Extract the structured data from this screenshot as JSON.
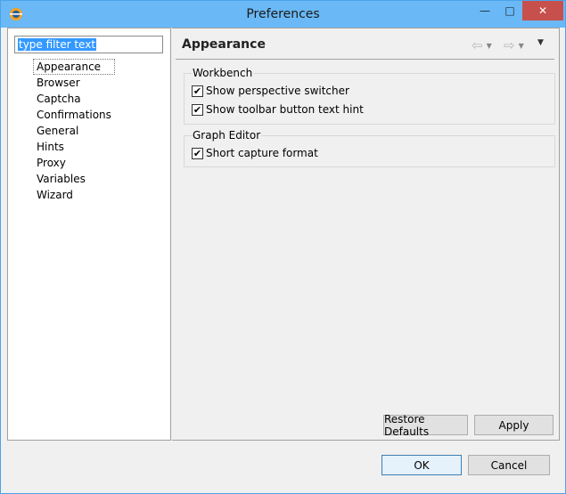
{
  "window": {
    "title": "Preferences",
    "icon": "eclipse-app-icon"
  },
  "title_controls": {
    "minimize": "—",
    "maximize": "□",
    "close": "✕"
  },
  "filter": {
    "value": "type filter text"
  },
  "tree": {
    "items": [
      {
        "label": "Appearance",
        "selected": true
      },
      {
        "label": "Browser"
      },
      {
        "label": "Captcha"
      },
      {
        "label": "Confirmations"
      },
      {
        "label": "General"
      },
      {
        "label": "Hints"
      },
      {
        "label": "Proxy"
      },
      {
        "label": "Variables"
      },
      {
        "label": "Wizard"
      }
    ]
  },
  "page": {
    "title": "Appearance",
    "nav": {
      "back_icon": "⇦",
      "forward_icon": "⇨",
      "dropdown_icon": "▼",
      "view_menu_icon": "▼"
    }
  },
  "groups": [
    {
      "label": "Workbench",
      "options": [
        {
          "label": "Show perspective switcher",
          "checked": true
        },
        {
          "label": "Show toolbar button text hint",
          "checked": true
        }
      ]
    },
    {
      "label": "Graph Editor",
      "options": [
        {
          "label": "Short capture format",
          "checked": true
        }
      ]
    }
  ],
  "buttons": {
    "restore_defaults": "Restore Defaults",
    "apply": "Apply",
    "ok": "OK",
    "cancel": "Cancel"
  },
  "check_mark": "✔"
}
